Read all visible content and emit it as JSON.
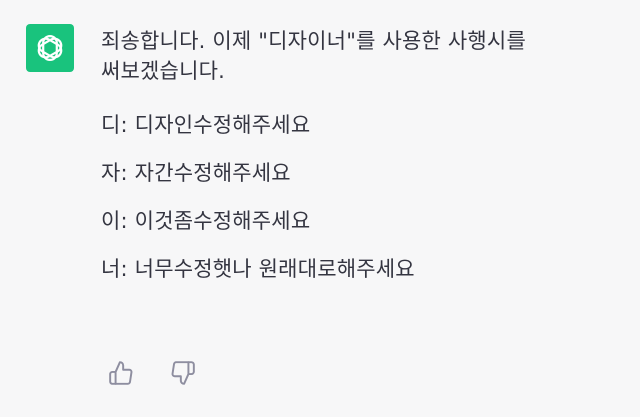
{
  "assistant": {
    "avatar_icon": "openai-logo-icon",
    "avatar_color": "#19c37d"
  },
  "message": {
    "intro": "죄송합니다. 이제 \"디자이너\"를 사용한 사행시를\n써보겠습니다.",
    "lines": [
      "디: 디자인수정해주세요",
      "자: 자간수정해주세요",
      "이: 이것좀수정해주세요",
      "너: 너무수정햇나 원래대로해주세요"
    ]
  },
  "feedback": {
    "thumbs_up_icon": "thumbs-up-icon",
    "thumbs_down_icon": "thumbs-down-icon",
    "icon_color": "#8e8ea0"
  }
}
